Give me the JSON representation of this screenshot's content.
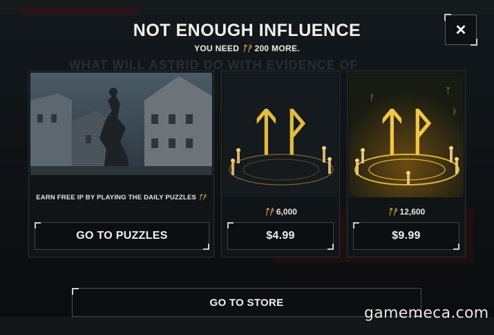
{
  "background": {
    "faint_title": "WHAT WILL ASTRID DO WITH EVIDENCE OF"
  },
  "modal": {
    "title": "NOT ENOUGH INFLUENCE",
    "subtitle_prefix": "YOU NEED",
    "subtitle_amount": "200",
    "subtitle_suffix": "MORE.",
    "currency_glyph": "ᛏᚹ",
    "close_label": "✕"
  },
  "cards": [
    {
      "caption": "EARN FREE IP BY PLAYING THE DAILY PUZZLES",
      "button_label": "GO TO PUZZLES"
    },
    {
      "amount": "6,000",
      "button_label": "$4.99"
    },
    {
      "amount": "12,600",
      "button_label": "$9.99"
    }
  ],
  "store_button_label": "GO TO STORE",
  "watermark": "gamemeca.com",
  "colors": {
    "accent_gold": "#e0b43c",
    "text": "#e9e7e1",
    "panel": "#101416"
  }
}
